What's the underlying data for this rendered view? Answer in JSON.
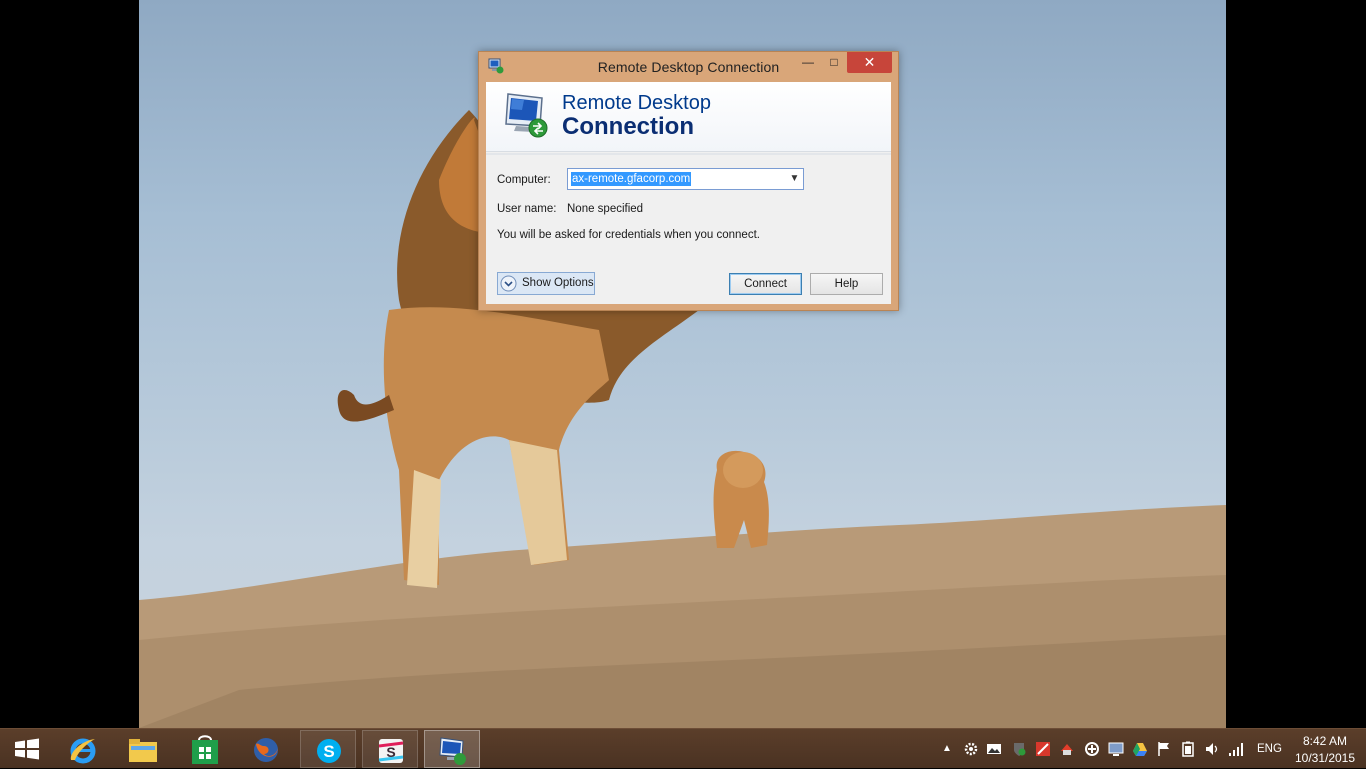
{
  "window": {
    "title": "Remote Desktop Connection",
    "min_glyph": "—",
    "max_glyph": "□",
    "close_glyph": "✕"
  },
  "banner": {
    "line1": "Remote Desktop",
    "line2": "Connection"
  },
  "form": {
    "computer_label": "Computer:",
    "computer_value": "ax-remote.gfacorp.com",
    "username_label": "User name:",
    "username_value": "None specified",
    "credentials_note": "You will be asked for credentials when you connect."
  },
  "buttons": {
    "show_options": "Show Options",
    "connect": "Connect",
    "help": "Help"
  },
  "taskbar": {
    "items": [
      {
        "name": "start-button",
        "icon": "windows-logo-icon"
      },
      {
        "name": "internet-explorer",
        "icon": "ie-icon"
      },
      {
        "name": "file-explorer",
        "icon": "folder-icon"
      },
      {
        "name": "windows-store",
        "icon": "store-icon"
      },
      {
        "name": "firefox",
        "icon": "firefox-icon"
      },
      {
        "name": "skype",
        "icon": "skype-icon"
      },
      {
        "name": "slack",
        "icon": "slack-icon"
      },
      {
        "name": "remote-desktop",
        "icon": "remote-desktop-icon"
      }
    ],
    "language": "ENG",
    "time": "8:42 AM",
    "date": "10/31/2015"
  },
  "colors": {
    "window_frame": "#d9a679",
    "close_button": "#c7453a",
    "banner_text": "#003a8c",
    "selection": "#3399ff",
    "taskbar": "#4f3524"
  }
}
